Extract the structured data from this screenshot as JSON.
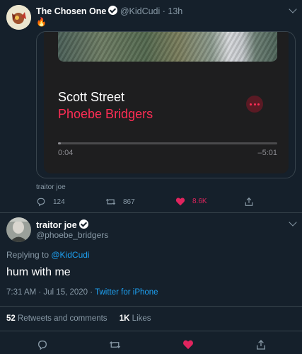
{
  "tweet1": {
    "display_name": "The Chosen One",
    "handle": "@KidCudi",
    "time": "· 13h",
    "text": "🔥",
    "card": {
      "song_title": "Scott Street",
      "artist": "Phoebe Bridgers",
      "elapsed": "0:04",
      "remaining": "–5:01",
      "progress_fraction": 0.013
    },
    "attribution": "traitor joe",
    "actions": {
      "replies": "124",
      "retweets": "867",
      "likes": "8.6K"
    }
  },
  "tweet2": {
    "display_name": "traitor joe",
    "handle": "@phoebe_bridgers",
    "replying_prefix": "Replying to ",
    "replying_to": "@KidCudi",
    "text": "hum with me",
    "timestamp": "7:31 AM · Jul 15, 2020 · ",
    "source": "Twitter for iPhone",
    "stats": {
      "retweets_count": "52",
      "retweets_label": "Retweets and comments",
      "likes_count": "1K",
      "likes_label": "Likes"
    }
  },
  "colors": {
    "background": "#15202b",
    "muted": "#8899a6",
    "link": "#1da1f2",
    "like": "#e0245e",
    "artist": "#ff2d55"
  },
  "icons": [
    "fire-emoji",
    "verified-badge-icon",
    "chevron-down-icon",
    "more-dots-icon",
    "reply-icon",
    "retweet-icon",
    "heart-icon",
    "share-icon"
  ]
}
